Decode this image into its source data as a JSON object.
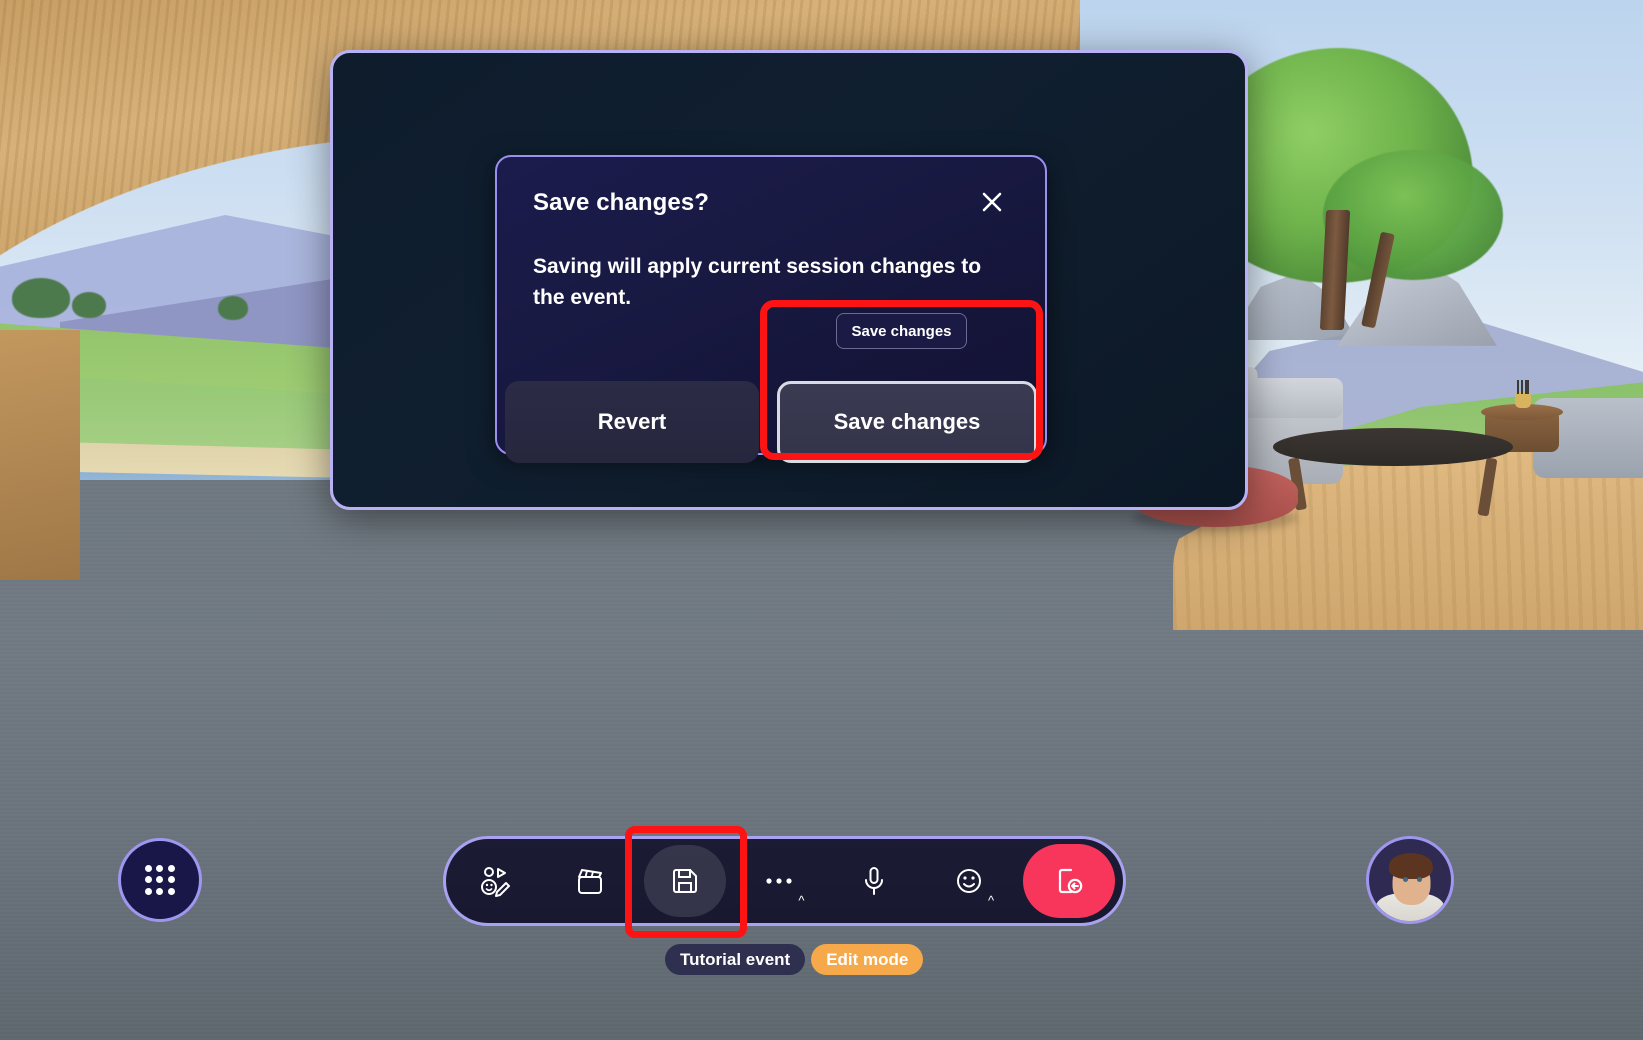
{
  "scene": {
    "name": "virtual-event-space",
    "description": "3D virtual lounge environment with wooden arch, landscape view, tree, sofa and coffee table"
  },
  "dialog": {
    "title": "Save changes?",
    "body": "Saving will apply current session changes to the event.",
    "close_label": "Close",
    "buttons": {
      "revert": "Revert",
      "save": "Save changes"
    }
  },
  "tooltip": {
    "label": "Save changes"
  },
  "toolbar": {
    "items": [
      {
        "name": "react-icon",
        "label": "Reactions"
      },
      {
        "name": "clapperboard-icon",
        "label": "Scene"
      },
      {
        "name": "save-icon",
        "label": "Save"
      },
      {
        "name": "more-icon",
        "label": "More"
      },
      {
        "name": "microphone-icon",
        "label": "Mute"
      },
      {
        "name": "emoji-icon",
        "label": "Emoji"
      },
      {
        "name": "leave-icon",
        "label": "Leave"
      }
    ]
  },
  "launcher": {
    "label": "Apps"
  },
  "avatar": {
    "label": "Your avatar"
  },
  "status": {
    "event_name": "Tutorial event",
    "mode": "Edit mode"
  },
  "colors": {
    "panel_border": "#b8b2f5",
    "dialog_border": "#9b8ff0",
    "annotation": "#fc1414",
    "leave_button": "#f8365c",
    "edit_mode_pill": "#f6a94a",
    "event_pill": "#2f2f4f"
  }
}
